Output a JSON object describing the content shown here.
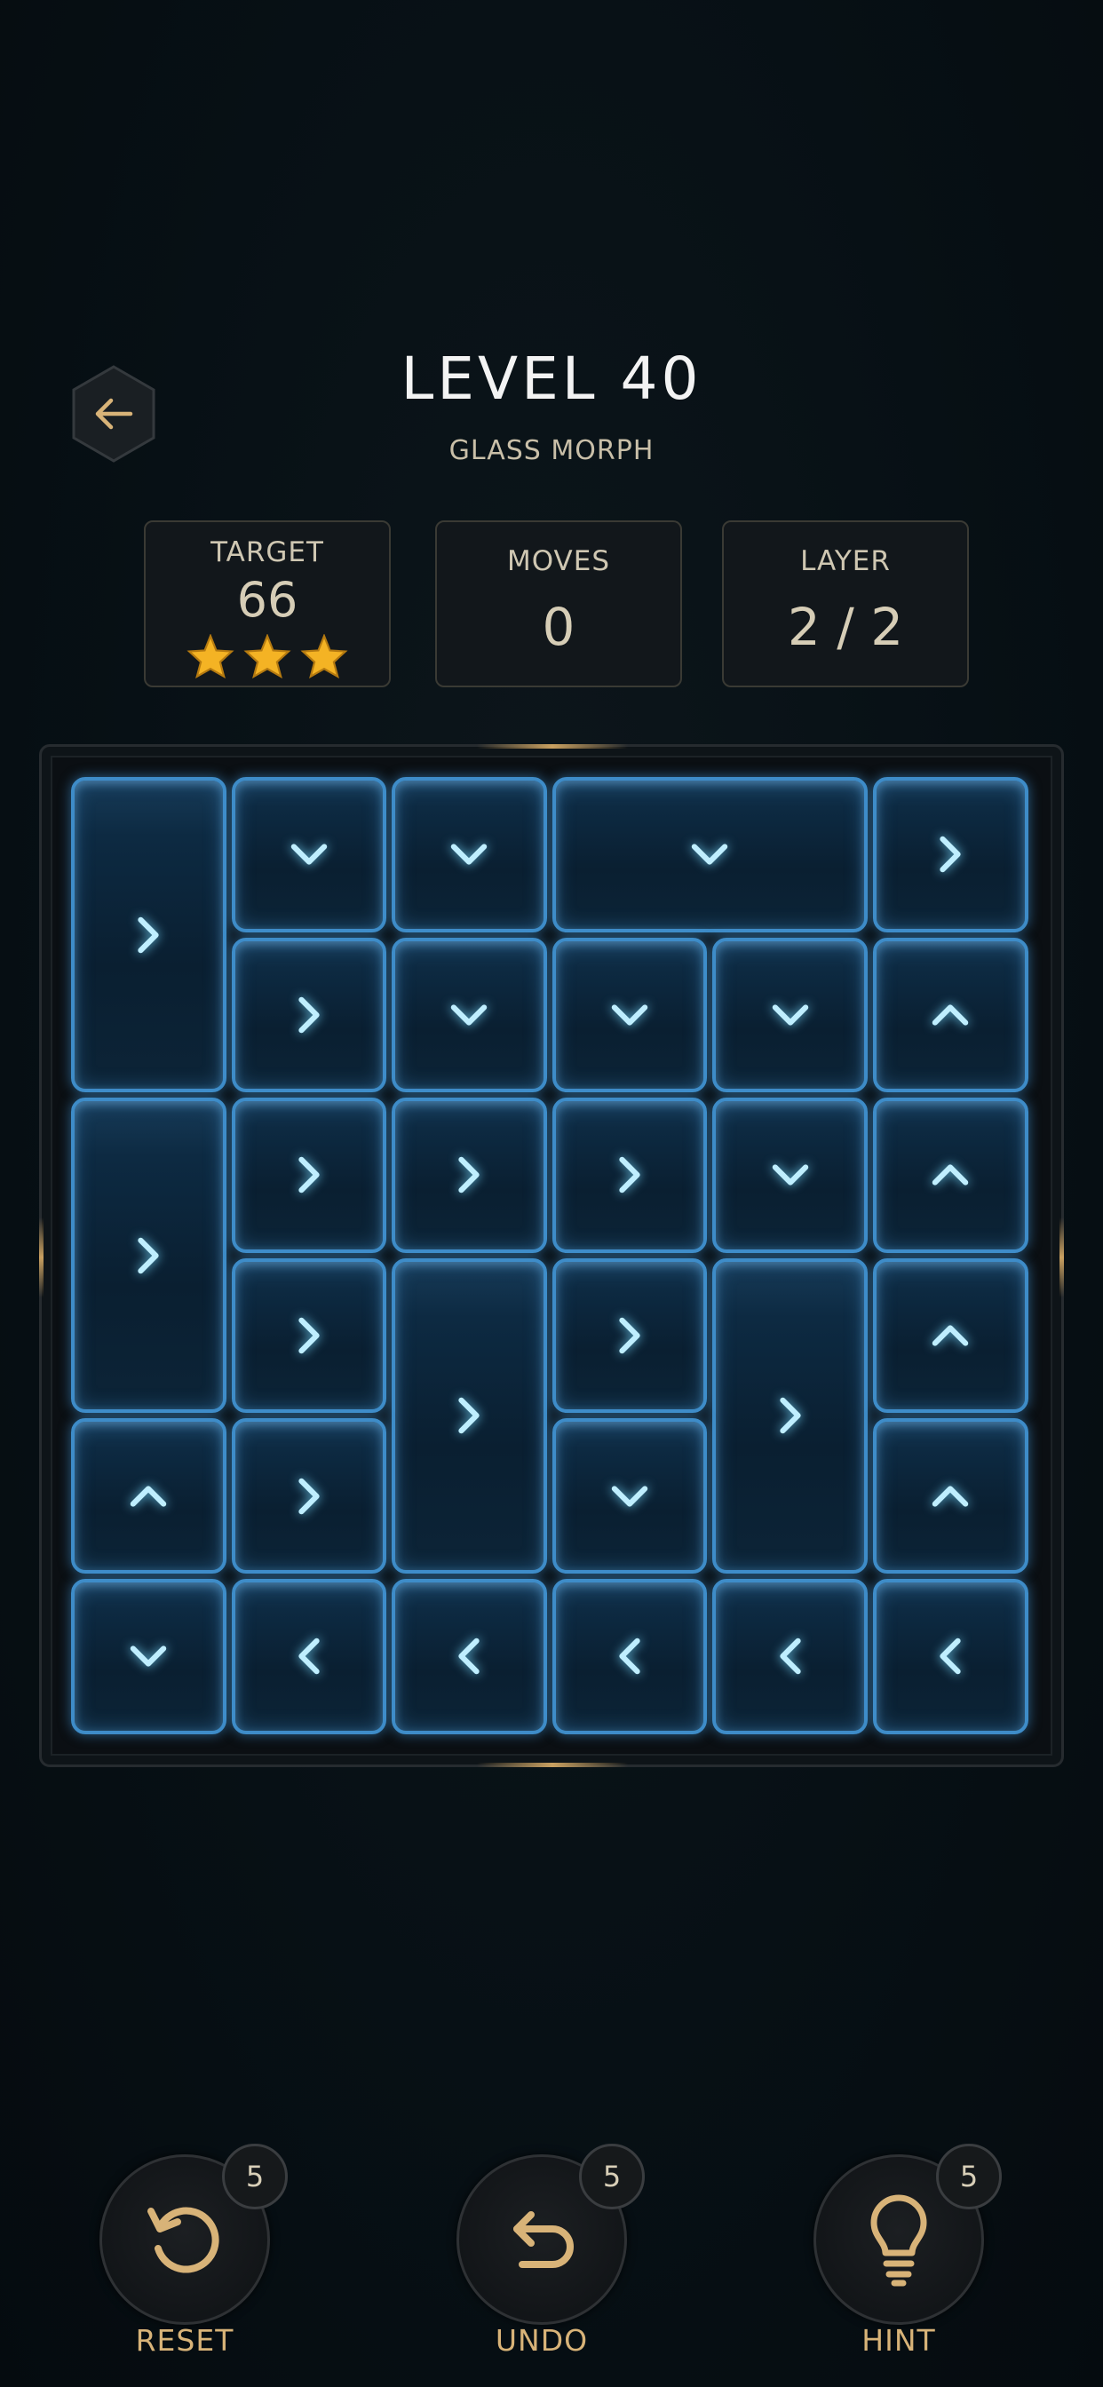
{
  "header": {
    "title": "LEVEL 40",
    "subtitle": "GLASS MORPH",
    "back_icon": "arrow-left-icon"
  },
  "stats": {
    "target_label": "TARGET",
    "target_value": "66",
    "stars_earned": 3,
    "moves_label": "MOVES",
    "moves_value": "0",
    "layer_label": "LAYER",
    "layer_value": "2 / 2"
  },
  "board": {
    "columns": 6,
    "rows": 6,
    "tiles": [
      {
        "col": 0,
        "row": 0,
        "w": 1,
        "h": 2,
        "dir": "right"
      },
      {
        "col": 1,
        "row": 0,
        "w": 1,
        "h": 1,
        "dir": "down"
      },
      {
        "col": 2,
        "row": 0,
        "w": 1,
        "h": 1,
        "dir": "down"
      },
      {
        "col": 3,
        "row": 0,
        "w": 2,
        "h": 1,
        "dir": "down"
      },
      {
        "col": 5,
        "row": 0,
        "w": 1,
        "h": 1,
        "dir": "right"
      },
      {
        "col": 1,
        "row": 1,
        "w": 1,
        "h": 1,
        "dir": "right"
      },
      {
        "col": 2,
        "row": 1,
        "w": 1,
        "h": 1,
        "dir": "down"
      },
      {
        "col": 3,
        "row": 1,
        "w": 1,
        "h": 1,
        "dir": "down"
      },
      {
        "col": 4,
        "row": 1,
        "w": 1,
        "h": 1,
        "dir": "down"
      },
      {
        "col": 5,
        "row": 1,
        "w": 1,
        "h": 1,
        "dir": "up"
      },
      {
        "col": 0,
        "row": 2,
        "w": 1,
        "h": 2,
        "dir": "right"
      },
      {
        "col": 1,
        "row": 2,
        "w": 1,
        "h": 1,
        "dir": "right"
      },
      {
        "col": 2,
        "row": 2,
        "w": 1,
        "h": 1,
        "dir": "right"
      },
      {
        "col": 3,
        "row": 2,
        "w": 1,
        "h": 1,
        "dir": "right"
      },
      {
        "col": 4,
        "row": 2,
        "w": 1,
        "h": 1,
        "dir": "down"
      },
      {
        "col": 5,
        "row": 2,
        "w": 1,
        "h": 1,
        "dir": "up"
      },
      {
        "col": 1,
        "row": 3,
        "w": 1,
        "h": 1,
        "dir": "right"
      },
      {
        "col": 2,
        "row": 3,
        "w": 1,
        "h": 2,
        "dir": "right"
      },
      {
        "col": 3,
        "row": 3,
        "w": 1,
        "h": 1,
        "dir": "right"
      },
      {
        "col": 4,
        "row": 3,
        "w": 1,
        "h": 2,
        "dir": "right"
      },
      {
        "col": 5,
        "row": 3,
        "w": 1,
        "h": 1,
        "dir": "up"
      },
      {
        "col": 0,
        "row": 4,
        "w": 1,
        "h": 1,
        "dir": "up"
      },
      {
        "col": 1,
        "row": 4,
        "w": 1,
        "h": 1,
        "dir": "right"
      },
      {
        "col": 3,
        "row": 4,
        "w": 1,
        "h": 1,
        "dir": "down"
      },
      {
        "col": 5,
        "row": 4,
        "w": 1,
        "h": 1,
        "dir": "up"
      },
      {
        "col": 0,
        "row": 5,
        "w": 1,
        "h": 1,
        "dir": "down"
      },
      {
        "col": 1,
        "row": 5,
        "w": 1,
        "h": 1,
        "dir": "left"
      },
      {
        "col": 2,
        "row": 5,
        "w": 1,
        "h": 1,
        "dir": "left"
      },
      {
        "col": 3,
        "row": 5,
        "w": 1,
        "h": 1,
        "dir": "left"
      },
      {
        "col": 4,
        "row": 5,
        "w": 1,
        "h": 1,
        "dir": "left"
      },
      {
        "col": 5,
        "row": 5,
        "w": 1,
        "h": 1,
        "dir": "left"
      }
    ]
  },
  "actions": {
    "reset": {
      "label": "RESET",
      "count": "5",
      "icon": "rotate-ccw-icon"
    },
    "undo": {
      "label": "UNDO",
      "count": "5",
      "icon": "undo-arrow-icon"
    },
    "hint": {
      "label": "HINT",
      "count": "5",
      "icon": "lightbulb-icon"
    }
  },
  "colors": {
    "accent_gold": "#d8b378",
    "tile_border": "#3e8cc8",
    "arrow": "#bfeeff"
  }
}
